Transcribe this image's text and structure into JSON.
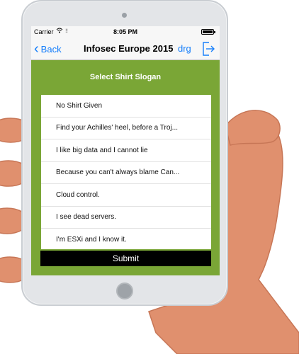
{
  "status_bar": {
    "carrier": "Carrier",
    "time": "8:05 PM",
    "wifi_icon": "wifi-icon",
    "battery_icon": "battery-icon"
  },
  "nav": {
    "back_label": "Back",
    "title": "Infosec Europe 2015",
    "user_label": "drg",
    "logout_icon": "logout-icon"
  },
  "section": {
    "header": "Select Shirt Slogan"
  },
  "slogans": [
    "No Shirt Given",
    "Find your Achilles' heel, before a Troj...",
    "I like big data and I cannot lie",
    "Because you can't always blame Can...",
    "Cloud control.",
    "I see dead servers.",
    "I'm ESXi and I know it."
  ],
  "submit_label": "Submit",
  "colors": {
    "accent": "#157efb",
    "background": "#7aa636",
    "submit": "#000000"
  }
}
